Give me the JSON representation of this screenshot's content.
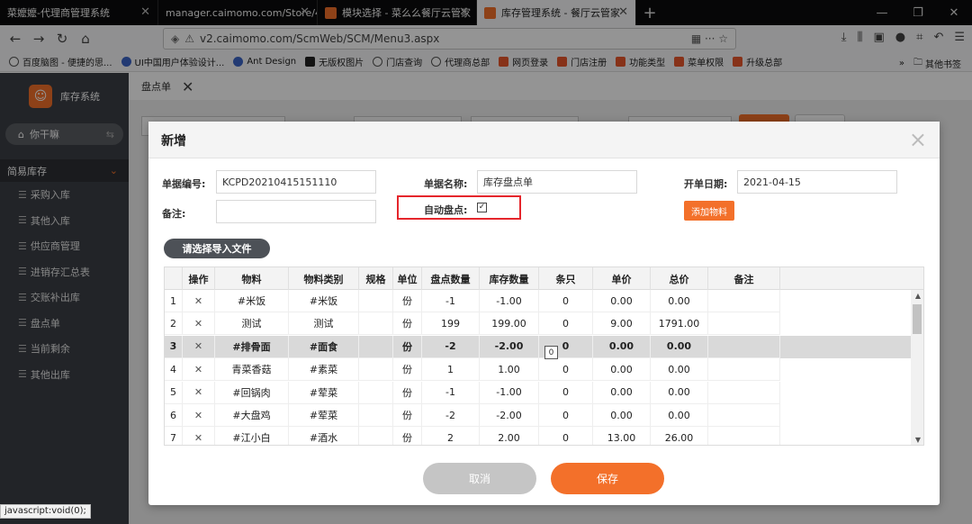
{
  "browser": {
    "tabs": [
      {
        "label": "菜嬤嬤-代理商管理系统"
      },
      {
        "label": "manager.caimomo.com/Store/4/"
      },
      {
        "label": "模块选择 - 菜么么餐厅云管家"
      },
      {
        "label": "库存管理系统 - 餐厅云管家"
      }
    ],
    "url": "v2.caimomo.com/ScmWeb/SCM/Menu3.aspx",
    "bookmarks": [
      "百度脑图 - 便捷的思...",
      "UI中国用户体验设计...",
      "Ant Design",
      "无版权图片",
      "门店查询",
      "代理商总部",
      "网页登录",
      "门店注册",
      "功能类型",
      "菜单权限",
      "升级总部"
    ],
    "other_bookmarks": "其他书签",
    "status": "javascript:void(0);"
  },
  "sidebar": {
    "app_title": "库存系统",
    "user": "你干嘛",
    "section": "简易库存",
    "items": [
      "采购入库",
      "其他入库",
      "供应商管理",
      "进销存汇总表",
      "交账补出库",
      "盘点单",
      "当前剩余",
      "其他出库"
    ]
  },
  "page_tab": "盘点单",
  "modal": {
    "title": "新增",
    "doc_no_label": "单据编号:",
    "doc_no_value": "KCPD20210415151110",
    "doc_name_label": "单据名称:",
    "doc_name_value": "库存盘点单",
    "open_date_label": "开单日期:",
    "open_date_value": "2021-04-15",
    "remark_label": "备注:",
    "remark_value": "",
    "auto_check_label": "自动盘点:",
    "auto_check_checked": true,
    "add_material": "添加物料",
    "import_btn": "请选择导入文件",
    "columns": [
      "操作",
      "物料",
      "物料类别",
      "规格",
      "单位",
      "盘点数量",
      "库存数量",
      "条只",
      "单价",
      "总价",
      "备注"
    ],
    "rows": [
      {
        "no": "1",
        "op": "✕",
        "material": "#米饭",
        "category": "#米饭",
        "spec": "",
        "unit": "份",
        "count_qty": "-1",
        "stock_qty": "-1.00",
        "pieces": "0",
        "price": "0.00",
        "total": "0.00",
        "note": ""
      },
      {
        "no": "2",
        "op": "✕",
        "material": "测试",
        "category": "测试",
        "spec": "",
        "unit": "份",
        "count_qty": "199",
        "stock_qty": "199.00",
        "pieces": "0",
        "price": "9.00",
        "total": "1791.00",
        "note": ""
      },
      {
        "no": "3",
        "op": "✕",
        "material": "#排骨面",
        "category": "#面食",
        "spec": "",
        "unit": "份",
        "count_qty": "-2",
        "stock_qty": "-2.00",
        "pieces": "0",
        "price": "0.00",
        "total": "0.00",
        "note": ""
      },
      {
        "no": "4",
        "op": "✕",
        "material": "青菜香菇",
        "category": "#素菜",
        "spec": "",
        "unit": "份",
        "count_qty": "1",
        "stock_qty": "1.00",
        "pieces": "0",
        "price": "0.00",
        "total": "0.00",
        "note": ""
      },
      {
        "no": "5",
        "op": "✕",
        "material": "#回锅肉",
        "category": "#荤菜",
        "spec": "",
        "unit": "份",
        "count_qty": "-1",
        "stock_qty": "-1.00",
        "pieces": "0",
        "price": "0.00",
        "total": "0.00",
        "note": ""
      },
      {
        "no": "6",
        "op": "✕",
        "material": "#大盘鸡",
        "category": "#荤菜",
        "spec": "",
        "unit": "份",
        "count_qty": "-2",
        "stock_qty": "-2.00",
        "pieces": "0",
        "price": "0.00",
        "total": "0.00",
        "note": ""
      },
      {
        "no": "7",
        "op": "✕",
        "material": "#江小白",
        "category": "#酒水",
        "spec": "",
        "unit": "份",
        "count_qty": "2",
        "stock_qty": "2.00",
        "pieces": "0",
        "price": "13.00",
        "total": "26.00",
        "note": ""
      }
    ],
    "selected_row": 3,
    "tooltip_value": "0",
    "cancel": "取消",
    "save": "保存"
  }
}
